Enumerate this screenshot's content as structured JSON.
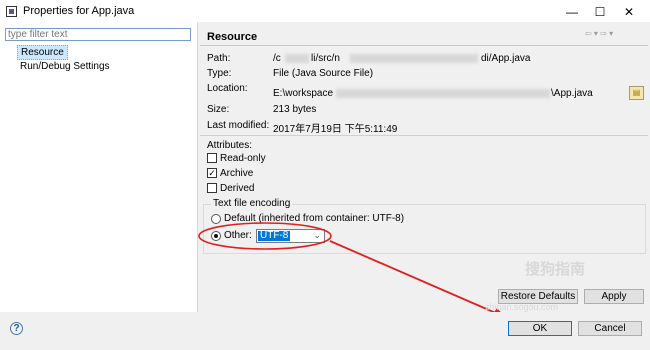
{
  "window": {
    "title": "Properties for App.java"
  },
  "filter": {
    "placeholder": "type filter text"
  },
  "nav": {
    "items": [
      {
        "label": "Resource"
      },
      {
        "label": "Run/Debug Settings"
      }
    ]
  },
  "resource": {
    "title": "Resource",
    "path_label": "Path:",
    "path_value_start": "/c",
    "path_value_mid": "li/src/n",
    "path_value_end": "di/App.java",
    "type_label": "Type:",
    "type_value": "File  (Java Source File)",
    "location_label": "Location:",
    "location_value_start": "E:\\workspace",
    "location_value_end": "\\App.java",
    "size_label": "Size:",
    "size_value": "213  bytes",
    "modified_label": "Last modified:",
    "modified_value": "2017年7月19日 下午5:11:49"
  },
  "attributes": {
    "label": "Attributes:",
    "items": [
      {
        "label": "Read-only",
        "checked": false
      },
      {
        "label": "Archive",
        "checked": true
      },
      {
        "label": "Derived",
        "checked": false
      }
    ]
  },
  "encoding": {
    "group_label": "Text file encoding",
    "default_label": "Default (inherited from container: UTF-8)",
    "other_label": "Other:",
    "other_value": "UTF-8",
    "selected": "other"
  },
  "buttons": {
    "restore": "Restore Defaults",
    "apply": "Apply",
    "ok": "OK",
    "cancel": "Cancel",
    "help": "?"
  },
  "watermark": {
    "main": "搜狗指南",
    "sub": "zhinan.sogou.com"
  },
  "colors": {
    "annotation": "#e02020",
    "selection": "#0078d7",
    "nav_selected": "#cce8ff"
  },
  "icons": {
    "window": "app-icon",
    "minimize": "minimize-icon",
    "maximize": "maximize-icon",
    "close": "close-icon",
    "help": "help-icon"
  }
}
